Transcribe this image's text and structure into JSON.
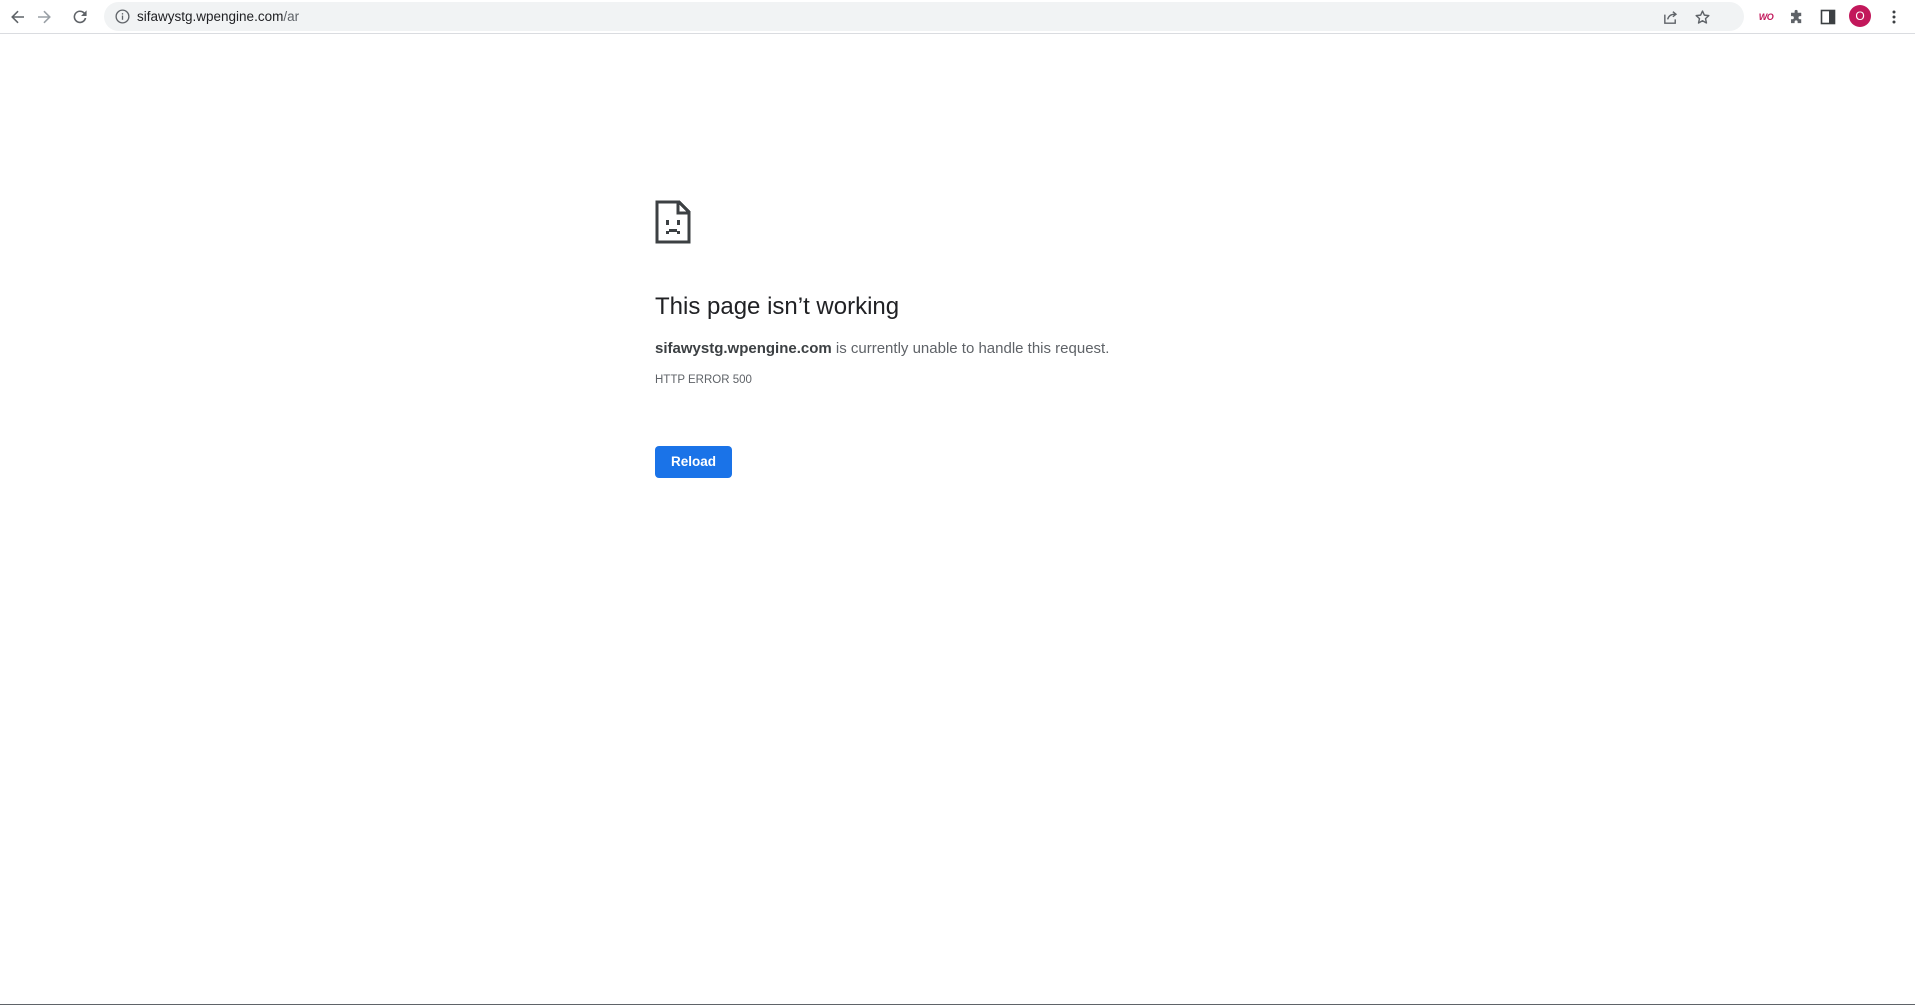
{
  "browser": {
    "url_host": "sifawystg.wpengine.com",
    "url_path": "/ar",
    "extension_logo_text": "WO",
    "avatar_initial": "O",
    "icons": {
      "back": "back-arrow-icon",
      "forward": "forward-arrow-icon",
      "reload": "reload-icon",
      "site_info": "info-icon",
      "share": "share-icon",
      "bookmark": "star-icon",
      "extensions": "puzzle-icon",
      "side_panel": "side-panel-icon",
      "menu": "kebab-menu-icon"
    },
    "accent_color": "#1a73e8",
    "avatar_color": "#c2185b"
  },
  "error_page": {
    "icon": "sad-page-icon",
    "title": "This page isn’t working",
    "host": "sifawystg.wpengine.com",
    "message": " is currently unable to handle this request.",
    "error_code": "HTTP ERROR 500",
    "reload_label": "Reload"
  }
}
